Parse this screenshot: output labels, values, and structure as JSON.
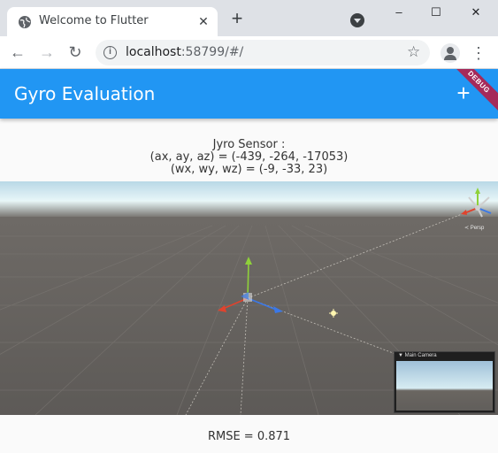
{
  "browser": {
    "tab_title": "Welcome to Flutter",
    "tab_close": "✕",
    "new_tab": "+",
    "url_host": "localhost",
    "url_rest": ":58799/#/",
    "minimize": "–",
    "maximize": "☐",
    "close": "✕",
    "icons": [
      "globe-icon",
      "back-arrow-icon",
      "forward-arrow-icon",
      "reload-icon",
      "info-icon",
      "star-icon",
      "profile-icon",
      "kebab-menu-icon"
    ]
  },
  "appbar": {
    "title": "Gyro Evaluation",
    "action_icon": "+",
    "debug_label": "DEBUG",
    "color": "#2196f3"
  },
  "sensor": {
    "heading": "Jyro Sensor :",
    "accel": "(ax, ay, az) = (-439, -264, -17053)",
    "gyro": "(wx, wy, wz) = (-9, -33, 23)"
  },
  "scene": {
    "persp_label": "≺ Persp",
    "camera_label": "▼ Main Camera"
  },
  "result": {
    "rmse": "RMSE = 0.871"
  }
}
